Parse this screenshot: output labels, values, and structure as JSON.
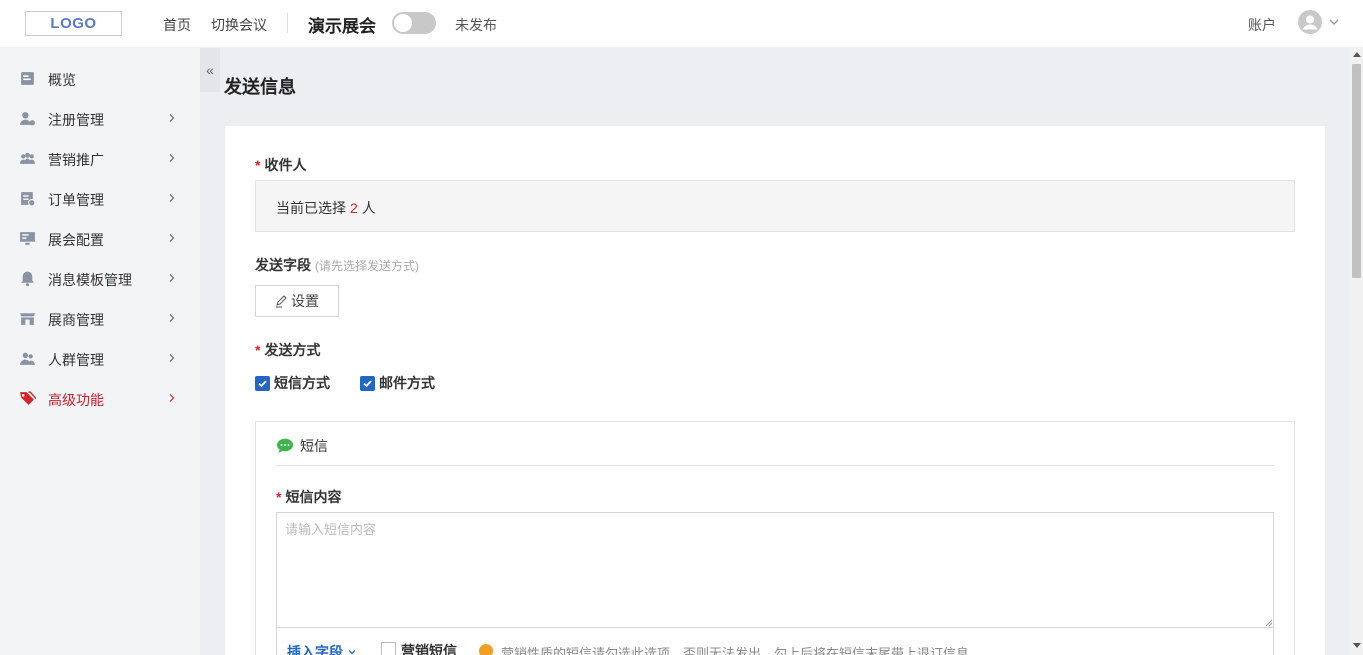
{
  "header": {
    "logo_text": "LOGO",
    "nav": [
      {
        "label": "首页"
      },
      {
        "label": "切换会议"
      }
    ],
    "expo_name": "演示展会",
    "publish_status": "未发布",
    "account_label": "账户"
  },
  "sidebar": {
    "items": [
      {
        "label": "概览",
        "icon": "overview-icon",
        "has_children": false
      },
      {
        "label": "注册管理",
        "icon": "user-register-icon",
        "has_children": true
      },
      {
        "label": "营销推广",
        "icon": "users-group-icon",
        "has_children": true
      },
      {
        "label": "订单管理",
        "icon": "order-icon",
        "has_children": true
      },
      {
        "label": "展会配置",
        "icon": "monitor-icon",
        "has_children": true
      },
      {
        "label": "消息模板管理",
        "icon": "bell-icon",
        "has_children": true
      },
      {
        "label": "展商管理",
        "icon": "store-icon",
        "has_children": true
      },
      {
        "label": "人群管理",
        "icon": "people-icon",
        "has_children": true
      },
      {
        "label": "高级功能",
        "icon": "tag-icon",
        "has_children": true,
        "active": true
      }
    ],
    "collapse_glyph": "«"
  },
  "page": {
    "title": "发送信息",
    "recipient": {
      "label": "收件人",
      "text_before": "当前已选择",
      "count": "2",
      "text_after": "人"
    },
    "send_fields": {
      "label": "发送字段",
      "hint": "(请先选择发送方式)",
      "button_label": "设置"
    },
    "send_method": {
      "label": "发送方式",
      "options": [
        {
          "label": "短信方式",
          "checked": true
        },
        {
          "label": "邮件方式",
          "checked": true
        }
      ]
    },
    "sms": {
      "title": "短信",
      "content_label": "短信内容",
      "placeholder": "请输入短信内容",
      "insert_field": "插入字段",
      "marketing_label": "营销短信",
      "marketing_checked": false,
      "warning": "营销性质的短信请勾选此选项，否则无法发出，勾上后将在短信末尾带上退订信息"
    }
  },
  "colors": {
    "accent_red": "#d8232a",
    "accent_blue": "#2267c5",
    "sidebar_bg": "#f3f4f6",
    "main_bg": "#eceef2"
  }
}
